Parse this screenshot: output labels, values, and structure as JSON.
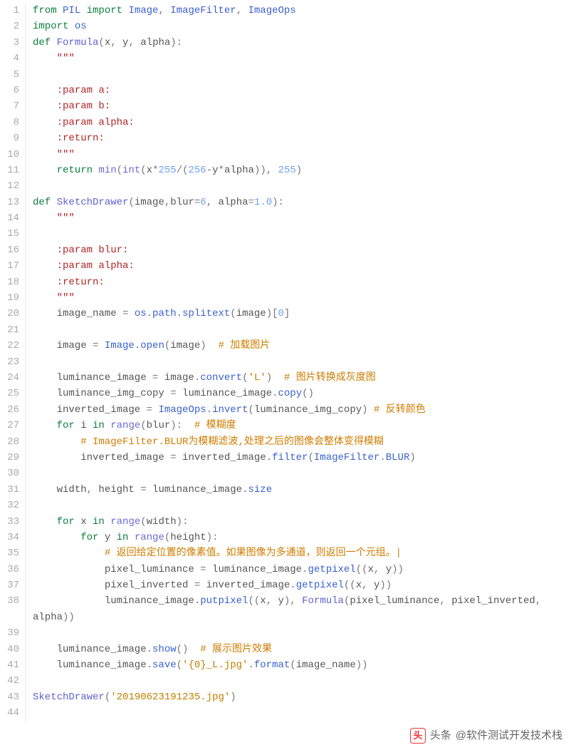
{
  "watermark": {
    "prefix": "头条",
    "handle": "@软件测试开发技术栈"
  },
  "code": {
    "lines": [
      {
        "n": 1,
        "tokens": [
          [
            "kw",
            "from "
          ],
          [
            "name",
            "PIL "
          ],
          [
            "kw",
            "import "
          ],
          [
            "name",
            "Image"
          ],
          [
            "punct",
            ", "
          ],
          [
            "name",
            "ImageFilter"
          ],
          [
            "punct",
            ", "
          ],
          [
            "name",
            "ImageOps"
          ]
        ]
      },
      {
        "n": 2,
        "tokens": [
          [
            "kw",
            "import "
          ],
          [
            "name",
            "os"
          ]
        ]
      },
      {
        "n": 3,
        "tokens": [
          [
            "kw",
            "def "
          ],
          [
            "fn",
            "Formula"
          ],
          [
            "punct",
            "("
          ],
          [
            "param",
            "x"
          ],
          [
            "punct",
            ", "
          ],
          [
            "param",
            "y"
          ],
          [
            "punct",
            ", "
          ],
          [
            "param",
            "alpha"
          ],
          [
            "punct",
            "):"
          ]
        ]
      },
      {
        "n": 4,
        "indent": 1,
        "tokens": [
          [
            "doc",
            "\"\"\""
          ]
        ]
      },
      {
        "n": 5,
        "tokens": []
      },
      {
        "n": 6,
        "indent": 1,
        "tokens": [
          [
            "doc",
            ":param a:"
          ]
        ]
      },
      {
        "n": 7,
        "indent": 1,
        "tokens": [
          [
            "doc",
            ":param b:"
          ]
        ]
      },
      {
        "n": 8,
        "indent": 1,
        "tokens": [
          [
            "doc",
            ":param alpha:"
          ]
        ]
      },
      {
        "n": 9,
        "indent": 1,
        "tokens": [
          [
            "doc",
            ":return:"
          ]
        ]
      },
      {
        "n": 10,
        "indent": 1,
        "tokens": [
          [
            "doc",
            "\"\"\""
          ]
        ]
      },
      {
        "n": 11,
        "indent": 1,
        "tokens": [
          [
            "kw",
            "return "
          ],
          [
            "builtin",
            "min"
          ],
          [
            "punct",
            "("
          ],
          [
            "builtin",
            "int"
          ],
          [
            "punct",
            "("
          ],
          [
            "param",
            "x"
          ],
          [
            "punct",
            "*"
          ],
          [
            "num",
            "255"
          ],
          [
            "punct",
            "/("
          ],
          [
            "num",
            "256"
          ],
          [
            "punct",
            "-"
          ],
          [
            "param",
            "y"
          ],
          [
            "punct",
            "*"
          ],
          [
            "param",
            "alpha"
          ],
          [
            "punct",
            ")), "
          ],
          [
            "num",
            "255"
          ],
          [
            "punct",
            ")"
          ]
        ]
      },
      {
        "n": 12,
        "tokens": []
      },
      {
        "n": 13,
        "tokens": [
          [
            "kw",
            "def "
          ],
          [
            "fn",
            "SketchDrawer"
          ],
          [
            "punct",
            "("
          ],
          [
            "param",
            "image"
          ],
          [
            "punct",
            ","
          ],
          [
            "param",
            "blur"
          ],
          [
            "punct",
            "="
          ],
          [
            "num",
            "6"
          ],
          [
            "punct",
            ", "
          ],
          [
            "param",
            "alpha"
          ],
          [
            "punct",
            "="
          ],
          [
            "num",
            "1.0"
          ],
          [
            "punct",
            "):"
          ]
        ]
      },
      {
        "n": 14,
        "indent": 1,
        "tokens": [
          [
            "doc",
            "\"\"\""
          ]
        ]
      },
      {
        "n": 15,
        "tokens": []
      },
      {
        "n": 16,
        "indent": 1,
        "tokens": [
          [
            "doc",
            ":param blur:"
          ]
        ]
      },
      {
        "n": 17,
        "indent": 1,
        "tokens": [
          [
            "doc",
            ":param alpha:"
          ]
        ]
      },
      {
        "n": 18,
        "indent": 1,
        "tokens": [
          [
            "doc",
            ":return:"
          ]
        ]
      },
      {
        "n": 19,
        "indent": 1,
        "tokens": [
          [
            "doc",
            "\"\"\""
          ]
        ]
      },
      {
        "n": 20,
        "indent": 1,
        "tokens": [
          [
            "param",
            "image_name "
          ],
          [
            "punct",
            "= "
          ],
          [
            "name",
            "os"
          ],
          [
            "punct",
            "."
          ],
          [
            "name",
            "path"
          ],
          [
            "punct",
            "."
          ],
          [
            "name",
            "splitext"
          ],
          [
            "punct",
            "("
          ],
          [
            "param",
            "image"
          ],
          [
            "punct",
            ")["
          ],
          [
            "num",
            "0"
          ],
          [
            "punct",
            "]"
          ]
        ]
      },
      {
        "n": 21,
        "tokens": []
      },
      {
        "n": 22,
        "indent": 1,
        "tokens": [
          [
            "param",
            "image "
          ],
          [
            "punct",
            "= "
          ],
          [
            "name",
            "Image"
          ],
          [
            "punct",
            "."
          ],
          [
            "name",
            "open"
          ],
          [
            "punct",
            "("
          ],
          [
            "param",
            "image"
          ],
          [
            "punct",
            ")  "
          ],
          [
            "comment",
            "# 加载图片"
          ]
        ]
      },
      {
        "n": 23,
        "tokens": []
      },
      {
        "n": 24,
        "indent": 1,
        "tokens": [
          [
            "param",
            "luminance_image "
          ],
          [
            "punct",
            "= "
          ],
          [
            "param",
            "image"
          ],
          [
            "punct",
            "."
          ],
          [
            "name",
            "convert"
          ],
          [
            "punct",
            "("
          ],
          [
            "str",
            "'L'"
          ],
          [
            "punct",
            ")  "
          ],
          [
            "comment",
            "# 图片转换成灰度图"
          ]
        ]
      },
      {
        "n": 25,
        "indent": 1,
        "tokens": [
          [
            "param",
            "luminance_img_copy "
          ],
          [
            "punct",
            "= "
          ],
          [
            "param",
            "luminance_image"
          ],
          [
            "punct",
            "."
          ],
          [
            "name",
            "copy"
          ],
          [
            "punct",
            "()"
          ]
        ]
      },
      {
        "n": 26,
        "indent": 1,
        "tokens": [
          [
            "param",
            "inverted_image "
          ],
          [
            "punct",
            "= "
          ],
          [
            "name",
            "ImageOps"
          ],
          [
            "punct",
            "."
          ],
          [
            "name",
            "invert"
          ],
          [
            "punct",
            "("
          ],
          [
            "param",
            "luminance_img_copy"
          ],
          [
            "punct",
            ") "
          ],
          [
            "comment",
            "# 反转颜色"
          ]
        ]
      },
      {
        "n": 27,
        "indent": 1,
        "tokens": [
          [
            "kw",
            "for "
          ],
          [
            "param",
            "i "
          ],
          [
            "kw",
            "in "
          ],
          [
            "builtin",
            "range"
          ],
          [
            "punct",
            "("
          ],
          [
            "param",
            "blur"
          ],
          [
            "punct",
            "):  "
          ],
          [
            "comment",
            "# 模糊度"
          ]
        ]
      },
      {
        "n": 28,
        "indent": 2,
        "tokens": [
          [
            "comment",
            "# ImageFilter.BLUR为模糊滤波,处理之后的图像会整体变得模糊"
          ]
        ]
      },
      {
        "n": 29,
        "indent": 2,
        "tokens": [
          [
            "param",
            "inverted_image "
          ],
          [
            "punct",
            "= "
          ],
          [
            "param",
            "inverted_image"
          ],
          [
            "punct",
            "."
          ],
          [
            "name",
            "filter"
          ],
          [
            "punct",
            "("
          ],
          [
            "name",
            "ImageFilter"
          ],
          [
            "punct",
            "."
          ],
          [
            "name",
            "BLUR"
          ],
          [
            "punct",
            ")"
          ]
        ]
      },
      {
        "n": 30,
        "tokens": []
      },
      {
        "n": 31,
        "indent": 1,
        "tokens": [
          [
            "param",
            "width"
          ],
          [
            "punct",
            ", "
          ],
          [
            "param",
            "height "
          ],
          [
            "punct",
            "= "
          ],
          [
            "param",
            "luminance_image"
          ],
          [
            "punct",
            "."
          ],
          [
            "name",
            "size"
          ]
        ]
      },
      {
        "n": 32,
        "tokens": []
      },
      {
        "n": 33,
        "indent": 1,
        "tokens": [
          [
            "kw",
            "for "
          ],
          [
            "param",
            "x "
          ],
          [
            "kw",
            "in "
          ],
          [
            "builtin",
            "range"
          ],
          [
            "punct",
            "("
          ],
          [
            "param",
            "width"
          ],
          [
            "punct",
            "):"
          ]
        ]
      },
      {
        "n": 34,
        "indent": 2,
        "tokens": [
          [
            "kw",
            "for "
          ],
          [
            "param",
            "y "
          ],
          [
            "kw",
            "in "
          ],
          [
            "builtin",
            "range"
          ],
          [
            "punct",
            "("
          ],
          [
            "param",
            "height"
          ],
          [
            "punct",
            "):"
          ]
        ]
      },
      {
        "n": 35,
        "indent": 3,
        "tokens": [
          [
            "comment",
            "# 返回给定位置的像素值。如果图像为多通道，则返回一个元组。|"
          ]
        ]
      },
      {
        "n": 36,
        "indent": 3,
        "tokens": [
          [
            "param",
            "pixel_luminance "
          ],
          [
            "punct",
            "= "
          ],
          [
            "param",
            "luminance_image"
          ],
          [
            "punct",
            "."
          ],
          [
            "name",
            "getpixel"
          ],
          [
            "punct",
            "(("
          ],
          [
            "param",
            "x"
          ],
          [
            "punct",
            ", "
          ],
          [
            "param",
            "y"
          ],
          [
            "punct",
            "))"
          ]
        ]
      },
      {
        "n": 37,
        "indent": 3,
        "tokens": [
          [
            "param",
            "pixel_inverted "
          ],
          [
            "punct",
            "= "
          ],
          [
            "param",
            "inverted_image"
          ],
          [
            "punct",
            "."
          ],
          [
            "name",
            "getpixel"
          ],
          [
            "punct",
            "(("
          ],
          [
            "param",
            "x"
          ],
          [
            "punct",
            ", "
          ],
          [
            "param",
            "y"
          ],
          [
            "punct",
            "))"
          ]
        ]
      },
      {
        "n": 38,
        "indent": 3,
        "tall": true,
        "tokens": [
          [
            "param",
            "luminance_image"
          ],
          [
            "punct",
            "."
          ],
          [
            "name",
            "putpixel"
          ],
          [
            "punct",
            "(("
          ],
          [
            "param",
            "x"
          ],
          [
            "punct",
            ", "
          ],
          [
            "param",
            "y"
          ],
          [
            "punct",
            "), "
          ],
          [
            "fn",
            "Formula"
          ],
          [
            "punct",
            "("
          ],
          [
            "param",
            "pixel_luminance"
          ],
          [
            "punct",
            ", "
          ],
          [
            "param",
            "pixel_inverted"
          ],
          [
            "punct",
            ", "
          ],
          [
            "param",
            "alpha"
          ],
          [
            "punct",
            "))"
          ]
        ]
      },
      {
        "n": 39,
        "tokens": []
      },
      {
        "n": 40,
        "indent": 1,
        "tokens": [
          [
            "param",
            "luminance_image"
          ],
          [
            "punct",
            "."
          ],
          [
            "name",
            "show"
          ],
          [
            "punct",
            "()  "
          ],
          [
            "comment",
            "# 展示图片效果"
          ]
        ]
      },
      {
        "n": 41,
        "indent": 1,
        "tokens": [
          [
            "param",
            "luminance_image"
          ],
          [
            "punct",
            "."
          ],
          [
            "name",
            "save"
          ],
          [
            "punct",
            "("
          ],
          [
            "str",
            "'{0}_L.jpg'"
          ],
          [
            "punct",
            "."
          ],
          [
            "name",
            "format"
          ],
          [
            "punct",
            "("
          ],
          [
            "param",
            "image_name"
          ],
          [
            "punct",
            "))"
          ]
        ]
      },
      {
        "n": 42,
        "tokens": []
      },
      {
        "n": 43,
        "tokens": [
          [
            "fn",
            "SketchDrawer"
          ],
          [
            "punct",
            "("
          ],
          [
            "str",
            "'20190623191235.jpg'"
          ],
          [
            "punct",
            ")"
          ]
        ]
      },
      {
        "n": 44,
        "tokens": []
      }
    ]
  }
}
